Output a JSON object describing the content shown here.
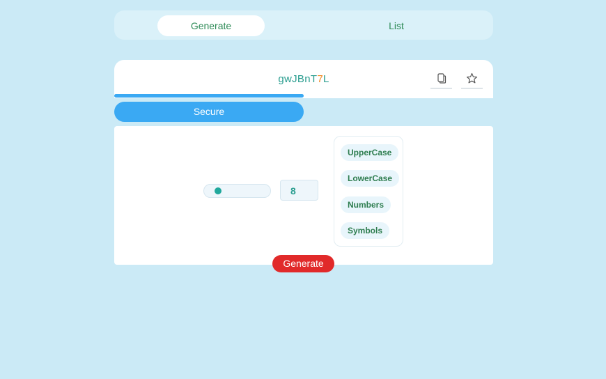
{
  "tabs": [
    {
      "label": "Generate",
      "active": true
    },
    {
      "label": "List",
      "active": false
    }
  ],
  "password": {
    "chars": [
      {
        "c": "g",
        "color": "#2a9d8f"
      },
      {
        "c": "w",
        "color": "#2a9d8f"
      },
      {
        "c": "J",
        "color": "#2a9d8f"
      },
      {
        "c": "B",
        "color": "#2a9d8f"
      },
      {
        "c": "n",
        "color": "#2a9d8f"
      },
      {
        "c": "T",
        "color": "#2a9d8f"
      },
      {
        "c": "7",
        "color": "#f08a24"
      },
      {
        "c": "L",
        "color": "#2a9d8f"
      }
    ],
    "copy_icon": "copy-icon",
    "star_icon": "star-icon"
  },
  "strength": {
    "label": "Secure",
    "level": 0.5,
    "color": "#3aa9f3"
  },
  "options": {
    "length": "8",
    "length_slider_fraction": 0.08,
    "toggles": [
      {
        "label": "UpperCase"
      },
      {
        "label": "LowerCase"
      },
      {
        "label": "Numbers"
      },
      {
        "label": "Symbols"
      }
    ]
  },
  "actions": {
    "generate_label": "Generate",
    "generate_color": "#e12a2a"
  },
  "colors": {
    "background": "#cbeaf6",
    "accent": "#2a9d8f",
    "text_green": "#2e8b57"
  }
}
